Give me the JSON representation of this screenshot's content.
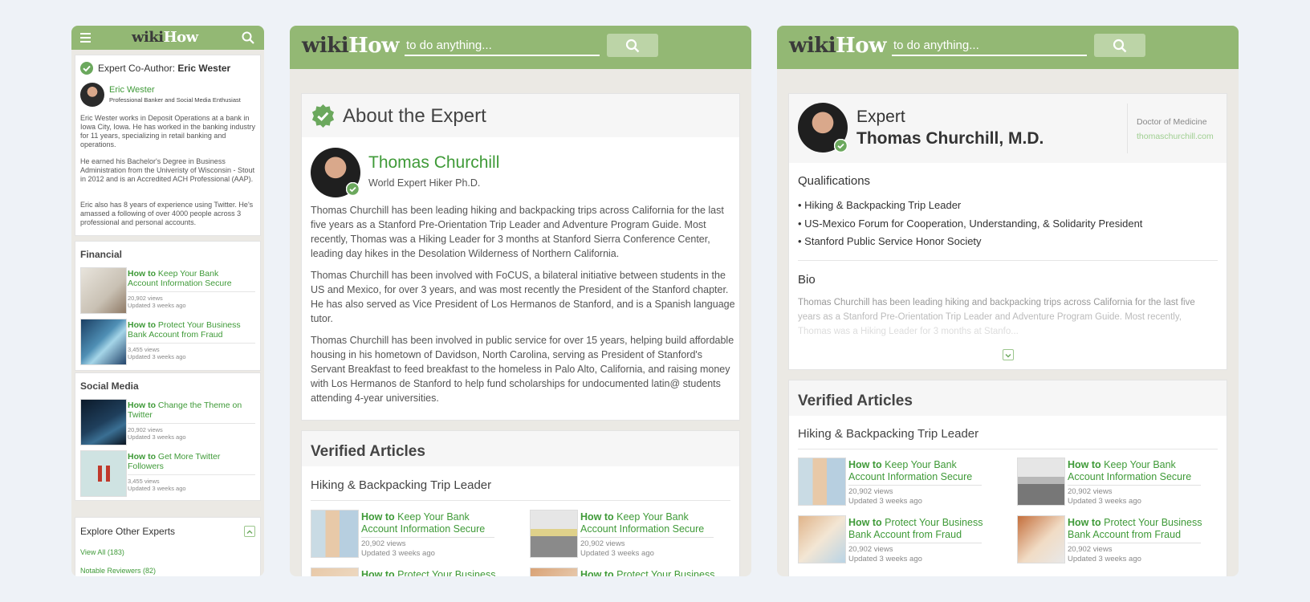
{
  "brand": {
    "wiki": "wiki",
    "how": "How"
  },
  "search_placeholder": "to do anything...",
  "colors": {
    "header_green": "#93b874",
    "link_green": "#3f9a38",
    "verify_green": "#6ba85d"
  },
  "mobile": {
    "coauthor_label": "Expert Co-Author: ",
    "coauthor_name": "Eric Wester",
    "author_name": "Eric Wester",
    "author_title": "Professional Banker and Social Media Enthusiast",
    "bio": [
      "Eric Wester works in Deposit Operations at a bank in Iowa City, Iowa. He has worked in the banking industry for 11 years, specializing in retail banking and operations.",
      "He earned his Bachelor's Degree in Business Administration from the Univeristy of Wisconsin - Stout in 2012 and is an Accredited ACH Professional (AAP).",
      "Eric also has 8 years of experience using Twitter. He's amassed a following of over 4000 people across 3 professional and personal accounts."
    ],
    "sections": [
      {
        "title": "Financial",
        "articles": [
          {
            "how": "How to",
            "title": " Keep Your Bank Account Information Secure",
            "views": "20,902 views",
            "updated": "Updated 3 weeks ago"
          },
          {
            "how": "How to",
            "title": " Protect Your Business Bank Account from Fraud",
            "views": "3,455 views",
            "updated": "Updated 3 weeks ago"
          }
        ]
      },
      {
        "title": "Social Media",
        "articles": [
          {
            "how": "How to",
            "title": " Change the Theme on Twitter",
            "views": "20,902 views",
            "updated": "Updated 3 weeks ago"
          },
          {
            "how": "How to",
            "title": " Get More Twitter Followers",
            "views": "3,455 views",
            "updated": "Updated 3 weeks ago"
          }
        ]
      }
    ],
    "explore_title": "Explore Other Experts",
    "explore_links": [
      "View All (183)",
      "Notable Reviewers (82)"
    ]
  },
  "center": {
    "section_title": "About the Expert",
    "expert_name": "Thomas Churchill",
    "expert_subtitle": "World Expert Hiker Ph.D.",
    "paragraphs": [
      "Thomas Churchill has been leading hiking and backpacking trips across California for the last five years as a Stanford Pre-Orientation Trip Leader and Adventure Program Guide. Most recently, Thomas was a Hiking Leader for 3 months at Stanford Sierra Conference Center, leading day hikes in the Desolation Wilderness of Northern California.",
      "Thomas Churchill has been involved with FoCUS, a bilateral initiative between students in the US and Mexico, for over 3 years, and was most recently the President of the Stanford chapter. He has also served as Vice President of Los Hermanos de Stanford, and is a Spanish language tutor.",
      "Thomas Churchill has been involved in public service for over 15 years, helping build affordable housing in his hometown of Davidson, North Carolina, serving as President of Stanford's Servant Breakfast to feed breakfast to the homeless in Palo Alto, California, and raising money with Los Hermanos de Stanford to help fund scholarships for undocumented latin@ students attending 4-year universities."
    ],
    "verified_title": "Verified Articles",
    "verified_sub": "Hiking & Backpacking Trip Leader",
    "articles": [
      {
        "how": "How to",
        "title": " Keep Your Bank Account Information Secure",
        "views": "20,902 views",
        "updated": "Updated 3 weeks ago"
      },
      {
        "how": "How to",
        "title": " Keep Your Bank Account Information Secure",
        "views": "20,902 views",
        "updated": "Updated 3 weeks ago"
      },
      {
        "how": "How to",
        "title": " Protect Your Business"
      },
      {
        "how": "How to",
        "title": " Protect Your Business"
      }
    ]
  },
  "right": {
    "expert_label": "Expert",
    "expert_name": "Thomas Churchill, M.D.",
    "degree": "Doctor of Medicine",
    "website": "thomaschurchill.com",
    "qualifications_title": "Qualifications",
    "qualifications": [
      "• Hiking & Backpacking Trip Leader",
      "• US-Mexico Forum for Cooperation, Understanding, & Solidarity President",
      "• Stanford Public Service Honor Society"
    ],
    "bio_title": "Bio",
    "bio_lines": [
      "Thomas Churchill has been leading hiking and backpacking trips across California for the last five",
      "years as a Stanford Pre-Orientation Trip Leader and Adventure Program Guide. Most recently,",
      "Thomas was a Hiking Leader for 3 months at Stanfo..."
    ],
    "verified_title": "Verified Articles",
    "verified_sub": "Hiking & Backpacking Trip Leader",
    "articles": [
      {
        "how": "How to",
        "title": " Keep Your Bank Account Information Secure",
        "views": "20,902 views",
        "updated": "Updated 3 weeks ago"
      },
      {
        "how": "How to",
        "title": " Keep Your Bank Account Information Secure",
        "views": "20,902 views",
        "updated": "Updated 3 weeks ago"
      },
      {
        "how": "How to",
        "title": " Protect Your Business Bank Account from Fraud",
        "views": "20,902 views",
        "updated": "Updated 3 weeks ago"
      },
      {
        "how": "How to",
        "title": " Protect Your Business Bank Account from Fraud",
        "views": "20,902 views",
        "updated": "Updated 3 weeks ago"
      }
    ]
  }
}
